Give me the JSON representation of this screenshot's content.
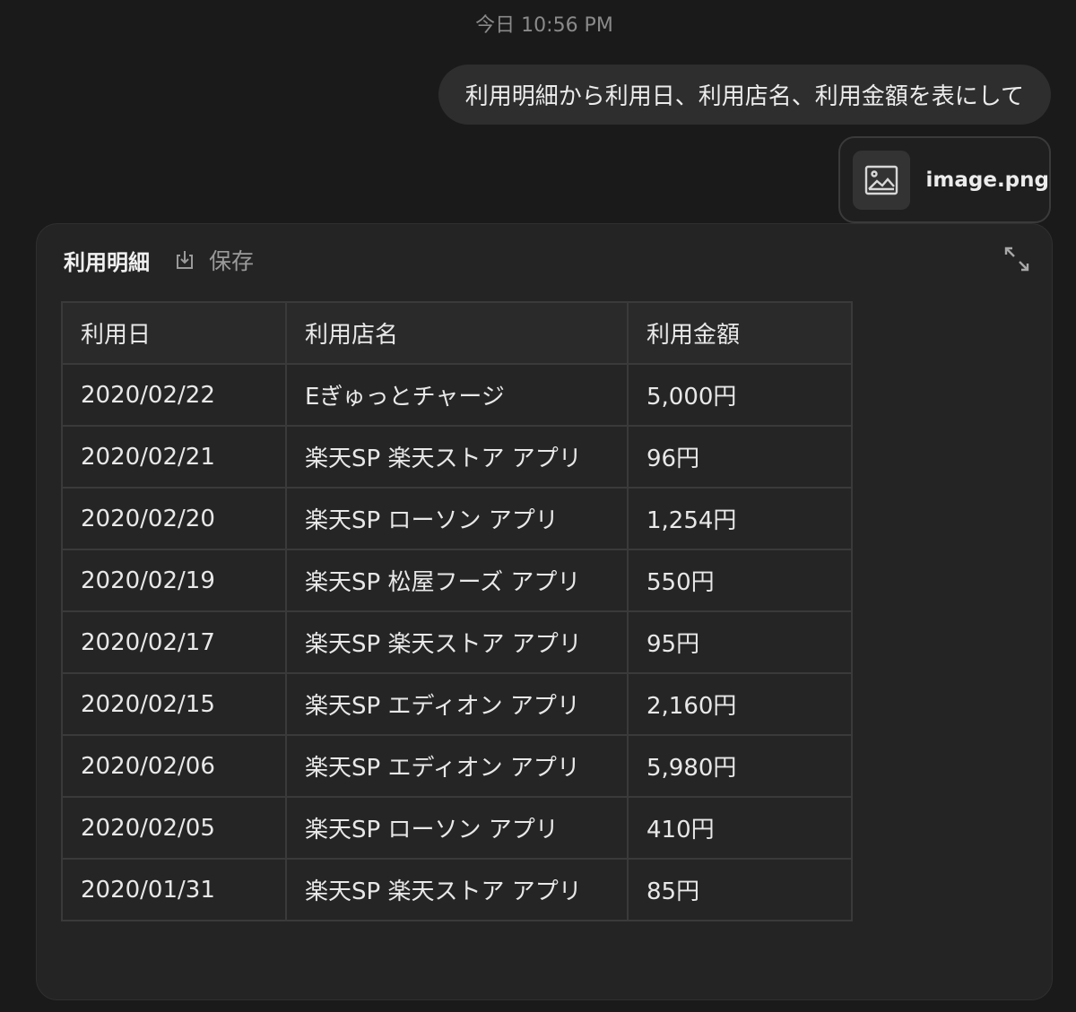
{
  "timestamp": "今日 10:56 PM",
  "user_message": "利用明細から利用日、利用店名、利用金額を表にして",
  "attachment": {
    "filename": "image.png",
    "icon": "image-icon"
  },
  "artifact": {
    "title": "利用明細",
    "save_label": "保存",
    "save_icon": "download-icon",
    "expand_icon": "expand-icon"
  },
  "table": {
    "headers": [
      "利用日",
      "利用店名",
      "利用金額"
    ],
    "rows": [
      [
        "2020/02/22",
        "Eぎゅっとチャージ",
        "5,000円"
      ],
      [
        "2020/02/21",
        "楽天SP 楽天ストア アプリ",
        "96円"
      ],
      [
        "2020/02/20",
        "楽天SP ローソン アプリ",
        "1,254円"
      ],
      [
        "2020/02/19",
        "楽天SP 松屋フーズ アプリ",
        "550円"
      ],
      [
        "2020/02/17",
        "楽天SP 楽天ストア アプリ",
        "95円"
      ],
      [
        "2020/02/15",
        "楽天SP エディオン アプリ",
        "2,160円"
      ],
      [
        "2020/02/06",
        "楽天SP エディオン アプリ",
        "5,980円"
      ],
      [
        "2020/02/05",
        "楽天SP ローソン アプリ",
        "410円"
      ],
      [
        "2020/01/31",
        "楽天SP 楽天ストア アプリ",
        "85円"
      ]
    ]
  },
  "colors": {
    "background": "#1a1a1a",
    "bubble": "#2e2e2e",
    "panel": "#242424",
    "border": "#3a3a3a",
    "muted_text": "#8a8a8a"
  }
}
